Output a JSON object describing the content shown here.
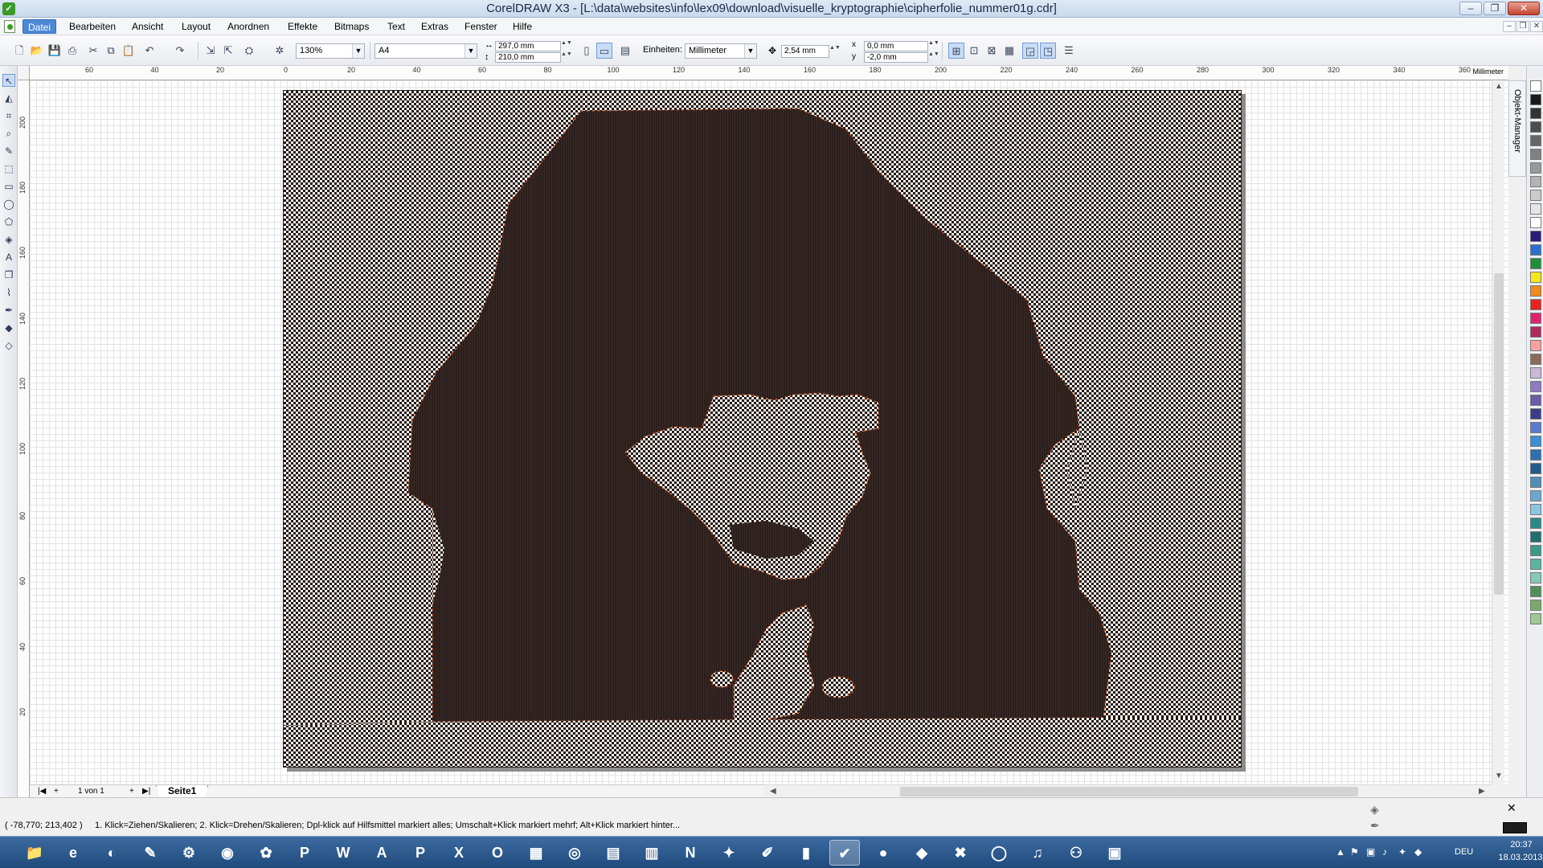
{
  "window": {
    "title": "CorelDRAW X3 - [L:\\data\\websites\\info\\lex09\\download\\visuelle_kryptographie\\cipherfolie_nummer01g.cdr]",
    "minimize": "–",
    "maximize": "❐",
    "close": "✕"
  },
  "menu": {
    "items": [
      "Datei",
      "Bearbeiten",
      "Ansicht",
      "Layout",
      "Anordnen",
      "Effekte",
      "Bitmaps",
      "Text",
      "Extras",
      "Fenster",
      "Hilfe"
    ],
    "active": "Datei"
  },
  "toolbar": {
    "zoom": "130%",
    "paper_size": "A4",
    "width": "297,0 mm",
    "height": "210,0 mm",
    "units_label": "Einheiten:",
    "units_value": "Millimeter",
    "nudge": "2,54 mm",
    "dup_x": "0,0 mm",
    "dup_y": "-2,0 mm"
  },
  "ruler": {
    "h_labels": [
      "60",
      "40",
      "20",
      "0",
      "20",
      "40",
      "60",
      "80",
      "100",
      "120",
      "140",
      "160",
      "180",
      "200",
      "220",
      "240",
      "260",
      "280",
      "300",
      "320",
      "340",
      "360"
    ],
    "v_labels": [
      "200",
      "180",
      "160",
      "140",
      "120",
      "100",
      "80",
      "60",
      "40",
      "20"
    ],
    "unit": "Millimeter"
  },
  "docker": {
    "label": "Objekt-Manager"
  },
  "pagenav": {
    "counter": "1 von 1",
    "tab": "Seite1"
  },
  "status": {
    "coords": "( -78,770; 213,402 )",
    "hint": "1. Klick=Ziehen/Skalieren; 2. Klick=Drehen/Skalieren; Dpl-klick auf Hilfsmittel markiert alles; Umschalt+Klick markiert mehrf; Alt+Klick markiert hinter..."
  },
  "palette": {
    "colors": [
      "#ffffff",
      "#1a1a1a",
      "#333333",
      "#4d4d4d",
      "#666666",
      "#808080",
      "#999999",
      "#b3b3b3",
      "#cccccc",
      "#e6e6e6",
      "#ffffff",
      "#2e1a7a",
      "#2a6fd1",
      "#1f8f3a",
      "#f5e51a",
      "#f08a1a",
      "#e8231f",
      "#e0236e",
      "#b42a5a",
      "#f7a0a0",
      "#8a6a5a",
      "#c9b8d6",
      "#8d7ac4",
      "#6d5aa8",
      "#3c3c8c",
      "#5a7ad1",
      "#3a8ed1",
      "#2f6fb3",
      "#1f5c8c",
      "#4f8fb8",
      "#6aa8d1",
      "#8ac4e0",
      "#2a8a8a",
      "#1f6f6f",
      "#3a9a8a",
      "#5ab4a0",
      "#88c8b8",
      "#4f8f5a",
      "#7aaa6a",
      "#a0c890"
    ]
  },
  "taskbar": {
    "language": "DEU",
    "time": "20:37",
    "date": "18.03.2013",
    "apps": [
      "explorer-icon",
      "ie-icon",
      "app3-icon",
      "app4-icon",
      "app5-icon",
      "media-icon",
      "app7-icon",
      "publisher-icon",
      "word-icon",
      "access-icon",
      "powerpoint-icon",
      "excel-icon",
      "outlook-icon",
      "app14-icon",
      "app15-icon",
      "app16-icon",
      "app17-icon",
      "onenote-icon",
      "app19-icon",
      "app20-icon",
      "app21-icon",
      "corel-icon",
      "app23-icon",
      "app24-icon",
      "app25-icon",
      "app26-icon",
      "app27-icon",
      "itunes-icon",
      "app29-icon"
    ],
    "app_glyphs": [
      "📁",
      "e",
      "◐",
      "✎",
      "⚙",
      "◉",
      "✿",
      "P",
      "W",
      "A",
      "P",
      "X",
      "O",
      "▦",
      "◎",
      "▤",
      "▥",
      "N",
      "✦",
      "✐",
      "▮",
      "✔",
      "●",
      "◆",
      "✖",
      "◯",
      "♫",
      "⚇",
      "▣"
    ]
  },
  "colors": {
    "accent": "#4d88d6",
    "hair_dark": "#2b1f1d",
    "checker_dark": "#201614",
    "checker_light": "#fbf4ee",
    "outline_orange": "#e65a1e"
  }
}
